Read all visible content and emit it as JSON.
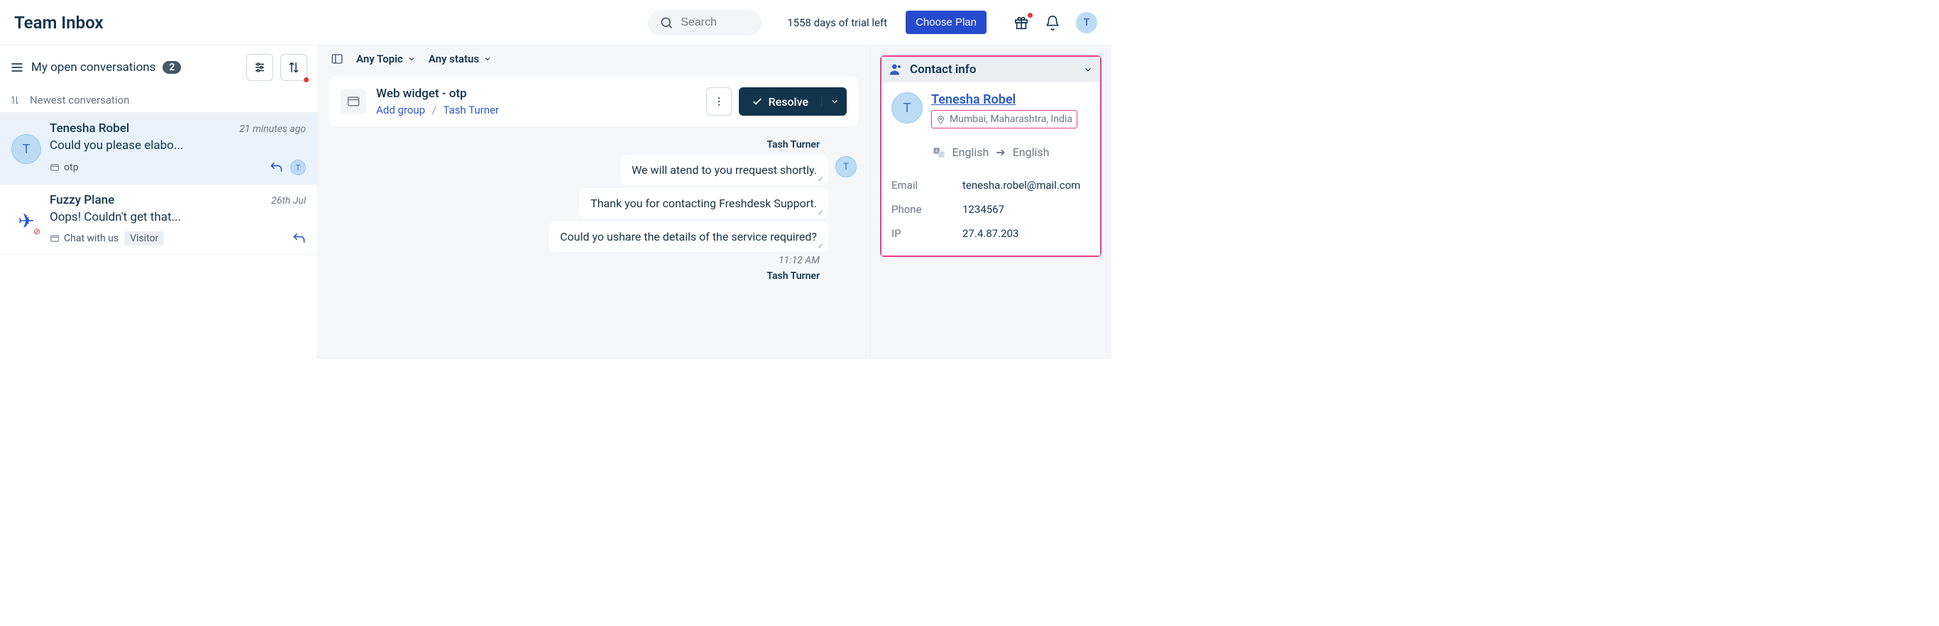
{
  "header": {
    "title": "Team Inbox",
    "search_placeholder": "Search",
    "trial_text": "1558 days of trial left",
    "choose_plan": "Choose Plan",
    "avatar_letter": "T"
  },
  "sidebar": {
    "view_label": "My open conversations",
    "count": "2",
    "sort_label": "Newest conversation",
    "items": [
      {
        "name": "Tenesha Robel",
        "time": "21 minutes ago",
        "snippet": "Could you please elabo...",
        "tag": "otp",
        "avatar": "T",
        "assigned_avatar": "T"
      },
      {
        "name": "Fuzzy Plane",
        "time": "26th Jul",
        "snippet": "Oops! Couldn't get that...",
        "tag": "Chat with us",
        "visitor_label": "Visitor"
      }
    ]
  },
  "filters": {
    "topic": "Any Topic",
    "status": "Any status"
  },
  "conversation": {
    "source": "Web widget - otp",
    "add_group": "Add group",
    "agent": "Tash Turner",
    "resolve": "Resolve",
    "agent_name": "Tash Turner",
    "agent_avatar": "T",
    "messages": [
      "We will atend to you rrequest shortly.",
      "Thank you for contacting Freshdesk Support.",
      "Could yo ushare the details of the service required?"
    ],
    "time": "11:12 AM",
    "agent_name2": "Tash Turner"
  },
  "contact": {
    "header": "Contact info",
    "name": "Tenesha Robel",
    "avatar": "T",
    "location": "Mumbai, Maharashtra, India",
    "lang_from": "English",
    "lang_to": "English",
    "fields": {
      "email_label": "Email",
      "email": "tenesha.robel@mail.com",
      "phone_label": "Phone",
      "phone": "1234567",
      "ip_label": "IP",
      "ip": "27.4.87.203"
    }
  }
}
